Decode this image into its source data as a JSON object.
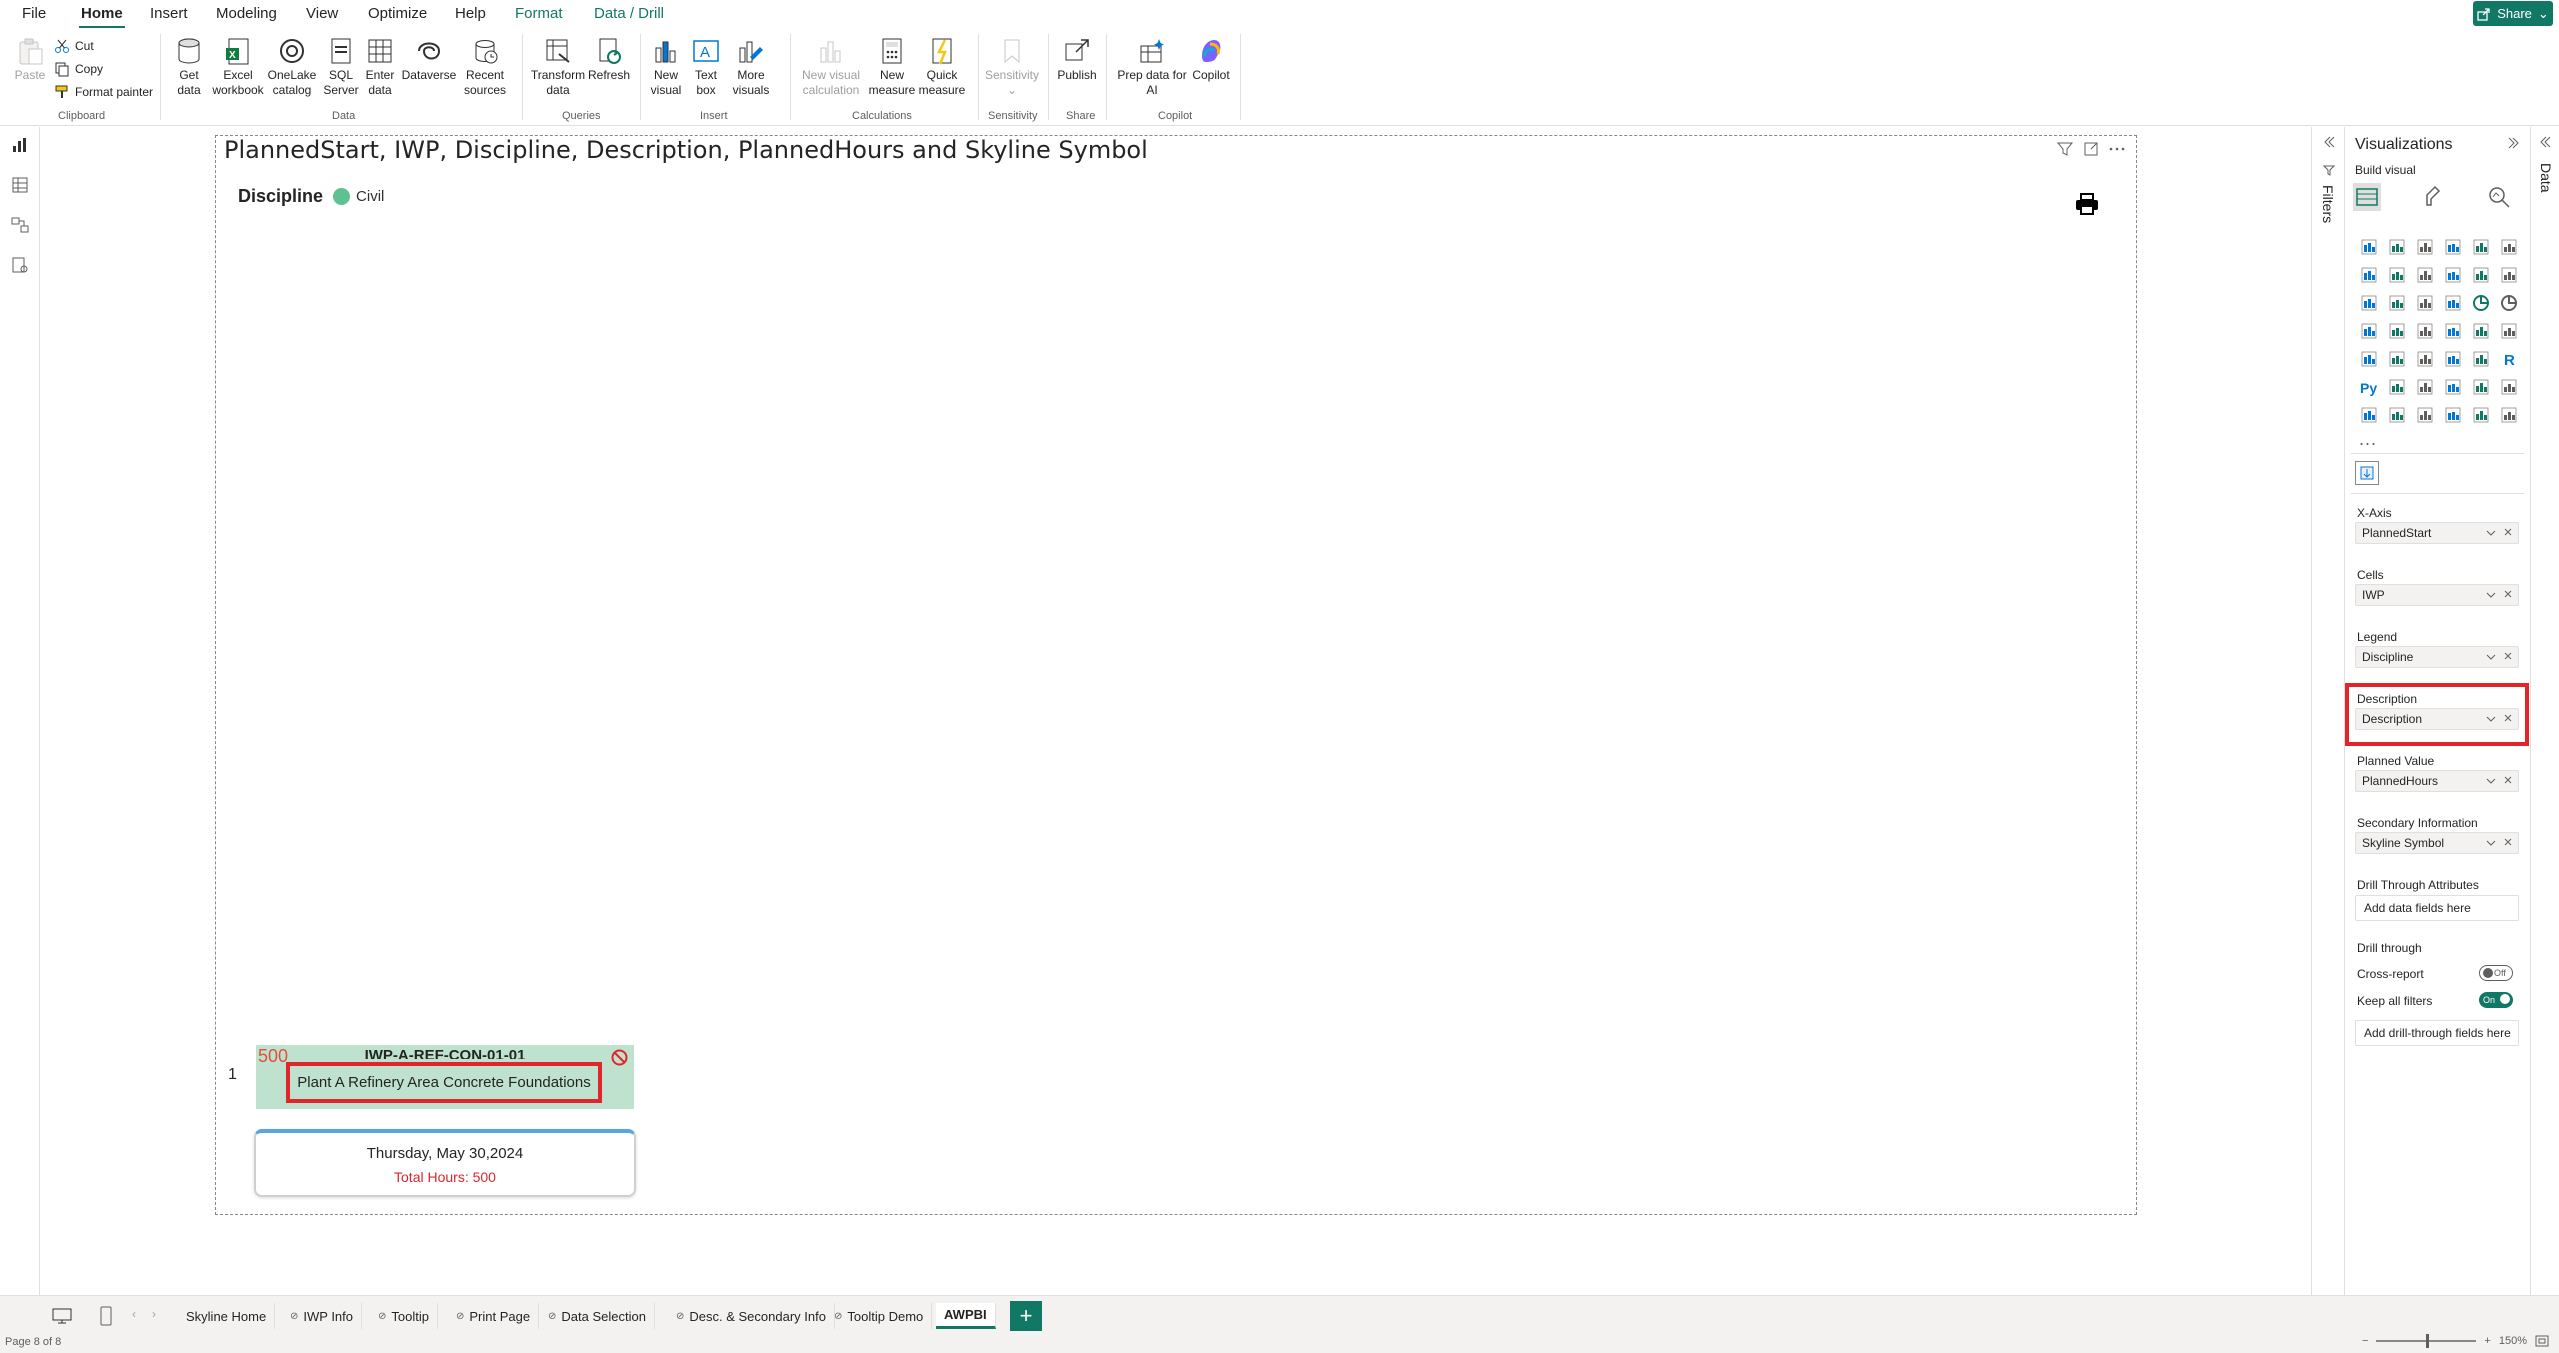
{
  "menu": {
    "tabs": [
      "File",
      "Home",
      "Insert",
      "Modeling",
      "View",
      "Optimize",
      "Help",
      "Format",
      "Data / Drill"
    ],
    "active": "Home",
    "share_label": "Share"
  },
  "ribbon": {
    "clipboard": {
      "paste": "Paste",
      "cut": "Cut",
      "copy": "Copy",
      "format_painter": "Format painter",
      "group": "Clipboard"
    },
    "data": {
      "get_data": [
        "Get",
        "data"
      ],
      "excel": [
        "Excel",
        "workbook"
      ],
      "onelake": [
        "OneLake",
        "catalog"
      ],
      "sql": [
        "SQL",
        "Server"
      ],
      "enter": [
        "Enter",
        "data"
      ],
      "dataverse": [
        "Dataverse"
      ],
      "recent": [
        "Recent",
        "sources"
      ],
      "group": "Data"
    },
    "queries": {
      "transform": [
        "Transform",
        "data"
      ],
      "refresh": [
        "Refresh"
      ],
      "group": "Queries"
    },
    "insert": {
      "new_visual": [
        "New",
        "visual"
      ],
      "text_box": [
        "Text",
        "box"
      ],
      "more_visuals": [
        "More",
        "visuals"
      ],
      "group": "Insert"
    },
    "calculations": {
      "new_visual_calc": [
        "New visual",
        "calculation"
      ],
      "new_measure": [
        "New",
        "measure"
      ],
      "quick_measure": [
        "Quick",
        "measure"
      ],
      "group": "Calculations"
    },
    "sensitivity": {
      "label": [
        "Sensitivity"
      ],
      "group": "Sensitivity"
    },
    "share": {
      "publish": [
        "Publish"
      ],
      "group": "Share"
    },
    "copilot": {
      "prep": [
        "Prep data for",
        "AI"
      ],
      "copilot": [
        "Copilot"
      ],
      "group": "Copilot"
    }
  },
  "visual": {
    "title": "PlannedStart, IWP, Discipline, Description, PlannedHours and Skyline Symbol",
    "legend_title": "Discipline",
    "legend_items": [
      {
        "label": "Civil",
        "color": "#5dc28f"
      }
    ],
    "row_number": "1",
    "cell": {
      "planned_value": "500",
      "iwp": "IWP-A-REF-CON-01-01",
      "description": "Plant A Refinery Area Concrete Foundations",
      "symbol_icon": "no-entry-icon",
      "color": "#bfe2cf"
    },
    "date_card": {
      "date": "Thursday, May 30,2024",
      "hours": "Total Hours: 500"
    }
  },
  "filters_pane": {
    "label": "Filters"
  },
  "viz_pane": {
    "title": "Visualizations",
    "build_visual": "Build visual",
    "more": "...",
    "wells": [
      {
        "label": "X-Axis",
        "field": "PlannedStart"
      },
      {
        "label": "Cells",
        "field": "IWP"
      },
      {
        "label": "Legend",
        "field": "Discipline"
      },
      {
        "label": "Description",
        "field": "Description"
      },
      {
        "label": "Planned Value",
        "field": "PlannedHours"
      },
      {
        "label": "Secondary Information",
        "field": "Skyline Symbol"
      }
    ],
    "drill_attrs_label": "Drill Through Attributes",
    "add_data_fields": "Add data fields here",
    "drill_through_label": "Drill through",
    "cross_report": "Cross-report",
    "cross_report_state": "Off",
    "keep_filters": "Keep all filters",
    "keep_filters_state": "On",
    "add_drill_fields": "Add drill-through fields here"
  },
  "data_pane": {
    "label": "Data"
  },
  "pages": {
    "tabs": [
      {
        "label": "Skyline Home",
        "hidden": false
      },
      {
        "label": "IWP Info",
        "hidden": true
      },
      {
        "label": "Tooltip",
        "hidden": true
      },
      {
        "label": "Print Page",
        "hidden": true
      },
      {
        "label": "Data Selection",
        "hidden": true
      },
      {
        "label": "Desc. & Secondary Info",
        "hidden": true
      },
      {
        "label": "Tooltip Demo",
        "hidden": true
      },
      {
        "label": "AWPBI",
        "hidden": false
      }
    ],
    "active": "AWPBI",
    "add": "+"
  },
  "status": {
    "page": "Page 8 of 8",
    "zoom_minus": "−",
    "zoom_plus": "+",
    "zoom": "150%"
  },
  "colors": {
    "accent": "#117865",
    "highlight": "#e0252b"
  }
}
